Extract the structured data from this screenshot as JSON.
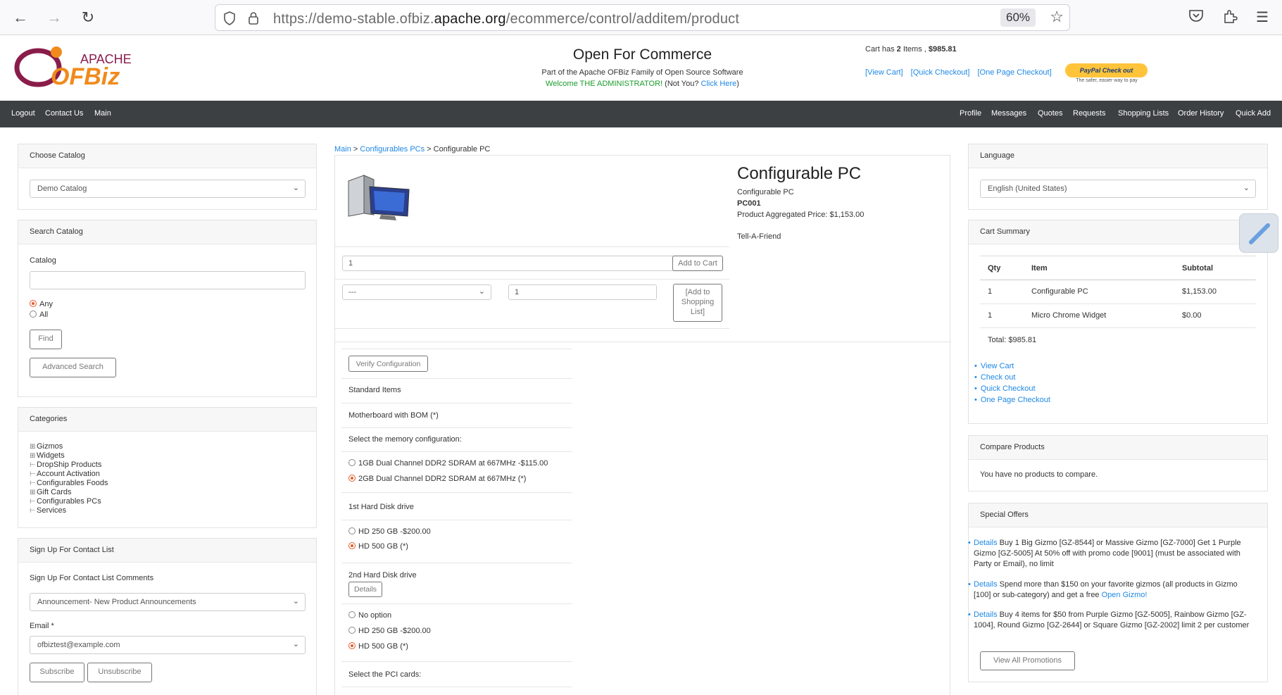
{
  "browser": {
    "url_prefix": "https://demo-stable.ofbiz.",
    "url_domain": "apache.org",
    "url_path": "/ecommerce/control/additem/product",
    "zoom": "60%"
  },
  "header": {
    "logo_top": "APACHE",
    "logo_main": "OFBiz",
    "title": "Open For Commerce",
    "subtitle": "Part of the Apache OFBiz Family of Open Source Software",
    "welcome": "Welcome THE ADMINISTRATOR!",
    "not_you": " (Not You? ",
    "click_here": "Click Here",
    "close_paren": ")",
    "cart_has_prefix": "Cart has ",
    "cart_count": "2",
    "cart_has_mid": " Items , ",
    "cart_total": "$985.81",
    "cart_links": [
      "[View Cart]",
      "[Quick Checkout]",
      "[One Page Checkout]"
    ],
    "paypal_label": "PayPal  Check out",
    "paypal_tagline": "The safer, easier way to pay"
  },
  "nav": {
    "left": [
      "Logout",
      "Contact Us",
      "Main"
    ],
    "right": [
      "Profile",
      "Messages",
      "Quotes",
      "Requests",
      "Shopping Lists",
      "Order History",
      "Quick Add"
    ]
  },
  "left": {
    "choose_catalog_title": "Choose Catalog",
    "catalog_selected": "Demo Catalog",
    "search_title": "Search Catalog",
    "catalog_label": "Catalog",
    "search_value": "",
    "radio_any": "Any",
    "radio_all": "All",
    "find_label": "Find",
    "advanced_label": "Advanced Search",
    "categories_title": "Categories",
    "categories": [
      {
        "label": "Gizmos",
        "expandable": true
      },
      {
        "label": "Widgets",
        "expandable": true
      },
      {
        "label": "DropShip Products",
        "expandable": false
      },
      {
        "label": "Account Activation",
        "expandable": false
      },
      {
        "label": "Configurables Foods",
        "expandable": false
      },
      {
        "label": "Gift Cards",
        "expandable": true
      },
      {
        "label": "Configurables PCs",
        "expandable": false
      },
      {
        "label": "Services",
        "expandable": false
      }
    ],
    "signup_title": "Sign Up For Contact List",
    "signup_comments_label": "Sign Up For Contact List Comments",
    "signup_selected": "Announcement- New Product Announcements",
    "email_label": "Email *",
    "email_value": "ofbiztest@example.com",
    "subscribe_label": "Subscribe",
    "unsubscribe_label": "Unsubscribe"
  },
  "center": {
    "breadcrumb": {
      "main": "Main",
      "sep1": " > ",
      "configurables": "Configurables PCs",
      "sep2": " > ",
      "current": "Configurable PC"
    },
    "product_title": "Configurable PC",
    "product_name": "Configurable PC",
    "product_id": "PC001",
    "price_label": "Product Aggregated Price: ",
    "price_value": "$1,153.00",
    "tell_friend": "Tell-A-Friend",
    "qty_value": "1",
    "add_to_cart": "Add to Cart",
    "list_select": "---",
    "list_qty": "1",
    "add_to_list": "[Add to Shopping List]",
    "verify_label": "Verify Configuration",
    "standard_items": "Standard Items",
    "motherboard": "Motherboard with BOM (*)",
    "memory_question": "Select the memory configuration:",
    "memory_options": [
      {
        "label": "1GB Dual Channel DDR2 SDRAM at 667MHz  -$115.00",
        "selected": false
      },
      {
        "label": "2GB Dual Channel DDR2 SDRAM at 667MHz  (*)",
        "selected": true
      }
    ],
    "hd1_title": "1st Hard Disk drive",
    "hd1_options": [
      {
        "label": "HD 250 GB  -$200.00",
        "selected": false
      },
      {
        "label": "HD 500 GB  (*)",
        "selected": true
      }
    ],
    "hd2_title": "2nd Hard Disk drive",
    "details_label": "Details",
    "hd2_options": [
      {
        "label": "No option",
        "selected": false
      },
      {
        "label": "HD 250 GB  -$200.00",
        "selected": false
      },
      {
        "label": "HD 500 GB  (*)",
        "selected": true
      }
    ],
    "pci_title": "Select the PCI cards:"
  },
  "right": {
    "language_title": "Language",
    "language_selected": "English (United States)",
    "cart_summary_title": "Cart Summary",
    "cart_headers": [
      "Qty",
      "Item",
      "Subtotal"
    ],
    "cart_rows": [
      {
        "qty": "1",
        "item": "Configurable PC",
        "subtotal": "$1,153.00"
      },
      {
        "qty": "1",
        "item": "Micro Chrome Widget",
        "subtotal": "$0.00"
      }
    ],
    "cart_total": "Total: $985.81",
    "cart_links": [
      "View Cart",
      "Check out",
      "Quick Checkout",
      "One Page Checkout"
    ],
    "compare_title": "Compare Products",
    "compare_text": "You have no products to compare.",
    "offers_title": "Special Offers",
    "offers": [
      {
        "details": "Details",
        "text": " Buy 1 Big Gizmo [GZ-8544] or Massive Gizmo [GZ-7000] Get 1 Purple Gizmo [GZ-5005] At 50% off with promo code [9001] (must be associated with Party or Email), no limit",
        "extra": ""
      },
      {
        "details": "Details",
        "text": " Spend more than $150 on your favorite gizmos (all products in Gizmo [100] or sub-category) and get a free ",
        "extra": "Open Gizmo!"
      },
      {
        "details": "Details",
        "text": " Buy 4 items for $50 from Purple Gizmo [GZ-5005], Rainbow Gizmo [GZ-1004], Round Gizmo [GZ-2644] or Square Gizmo [GZ-2002] limit 2 per customer",
        "extra": ""
      }
    ],
    "view_promotions": "View All Promotions"
  }
}
